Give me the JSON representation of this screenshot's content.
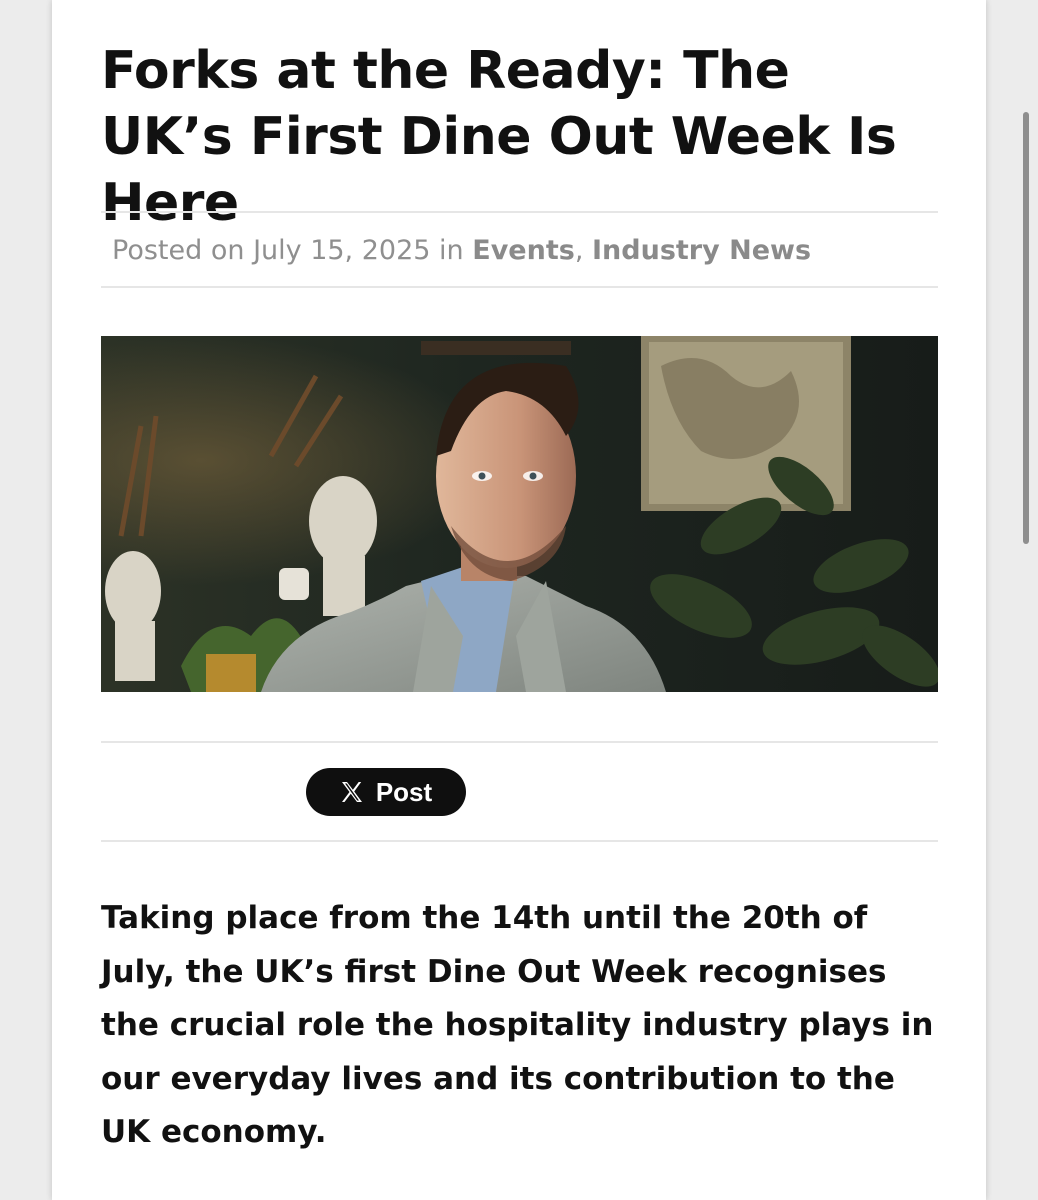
{
  "article": {
    "title": "Forks at the Ready: The UK’s First Dine Out Week Is Here",
    "meta": {
      "prefix": "Posted on",
      "date": "July 15, 2025",
      "in_word": "in",
      "categories": [
        "Events",
        "Industry News"
      ],
      "separator": ","
    },
    "share": {
      "x_post_label": "Post",
      "icon": "x-logo-icon"
    },
    "body": "Taking place from the 14th until the 20th of July, the UK’s first Dine Out Week recognises the crucial role the hospitality industry plays in our everyday lives and its contribution to the UK economy."
  },
  "colors": {
    "background": "#ececec",
    "card": "#ffffff",
    "title": "#111111",
    "meta": "#8f8f8f",
    "divider": "#e6e6e6",
    "x_button": "#0f0f0f",
    "scrollbar": "#8e8e8e"
  }
}
